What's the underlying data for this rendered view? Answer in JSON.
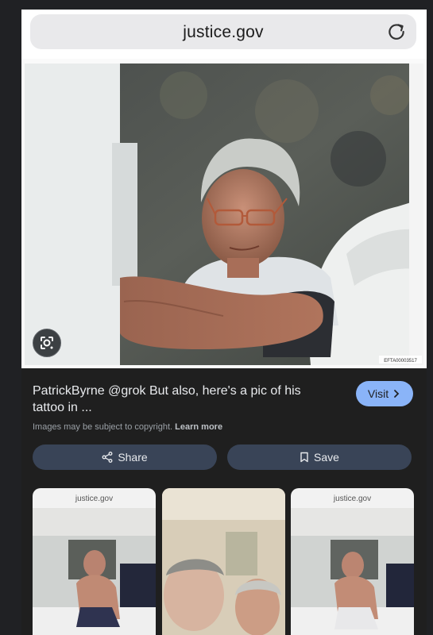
{
  "browser": {
    "url": "justice.gov"
  },
  "preview": {
    "watermark": "EFTA00003517"
  },
  "result": {
    "title": "PatrickByrne @grok But also, here's a pic of his tattoo in ...",
    "visit_label": "Visit",
    "copyright_text": "Images may be subject to copyright.",
    "learn_more": "Learn more",
    "share_label": "Share",
    "save_label": "Save"
  },
  "related": [
    {
      "label": "justice.gov"
    },
    {
      "label": ""
    },
    {
      "label": "justice.gov"
    }
  ],
  "colors": {
    "background": "#202124",
    "visit_button": "#8ab4f8",
    "action_button": "#394457"
  }
}
